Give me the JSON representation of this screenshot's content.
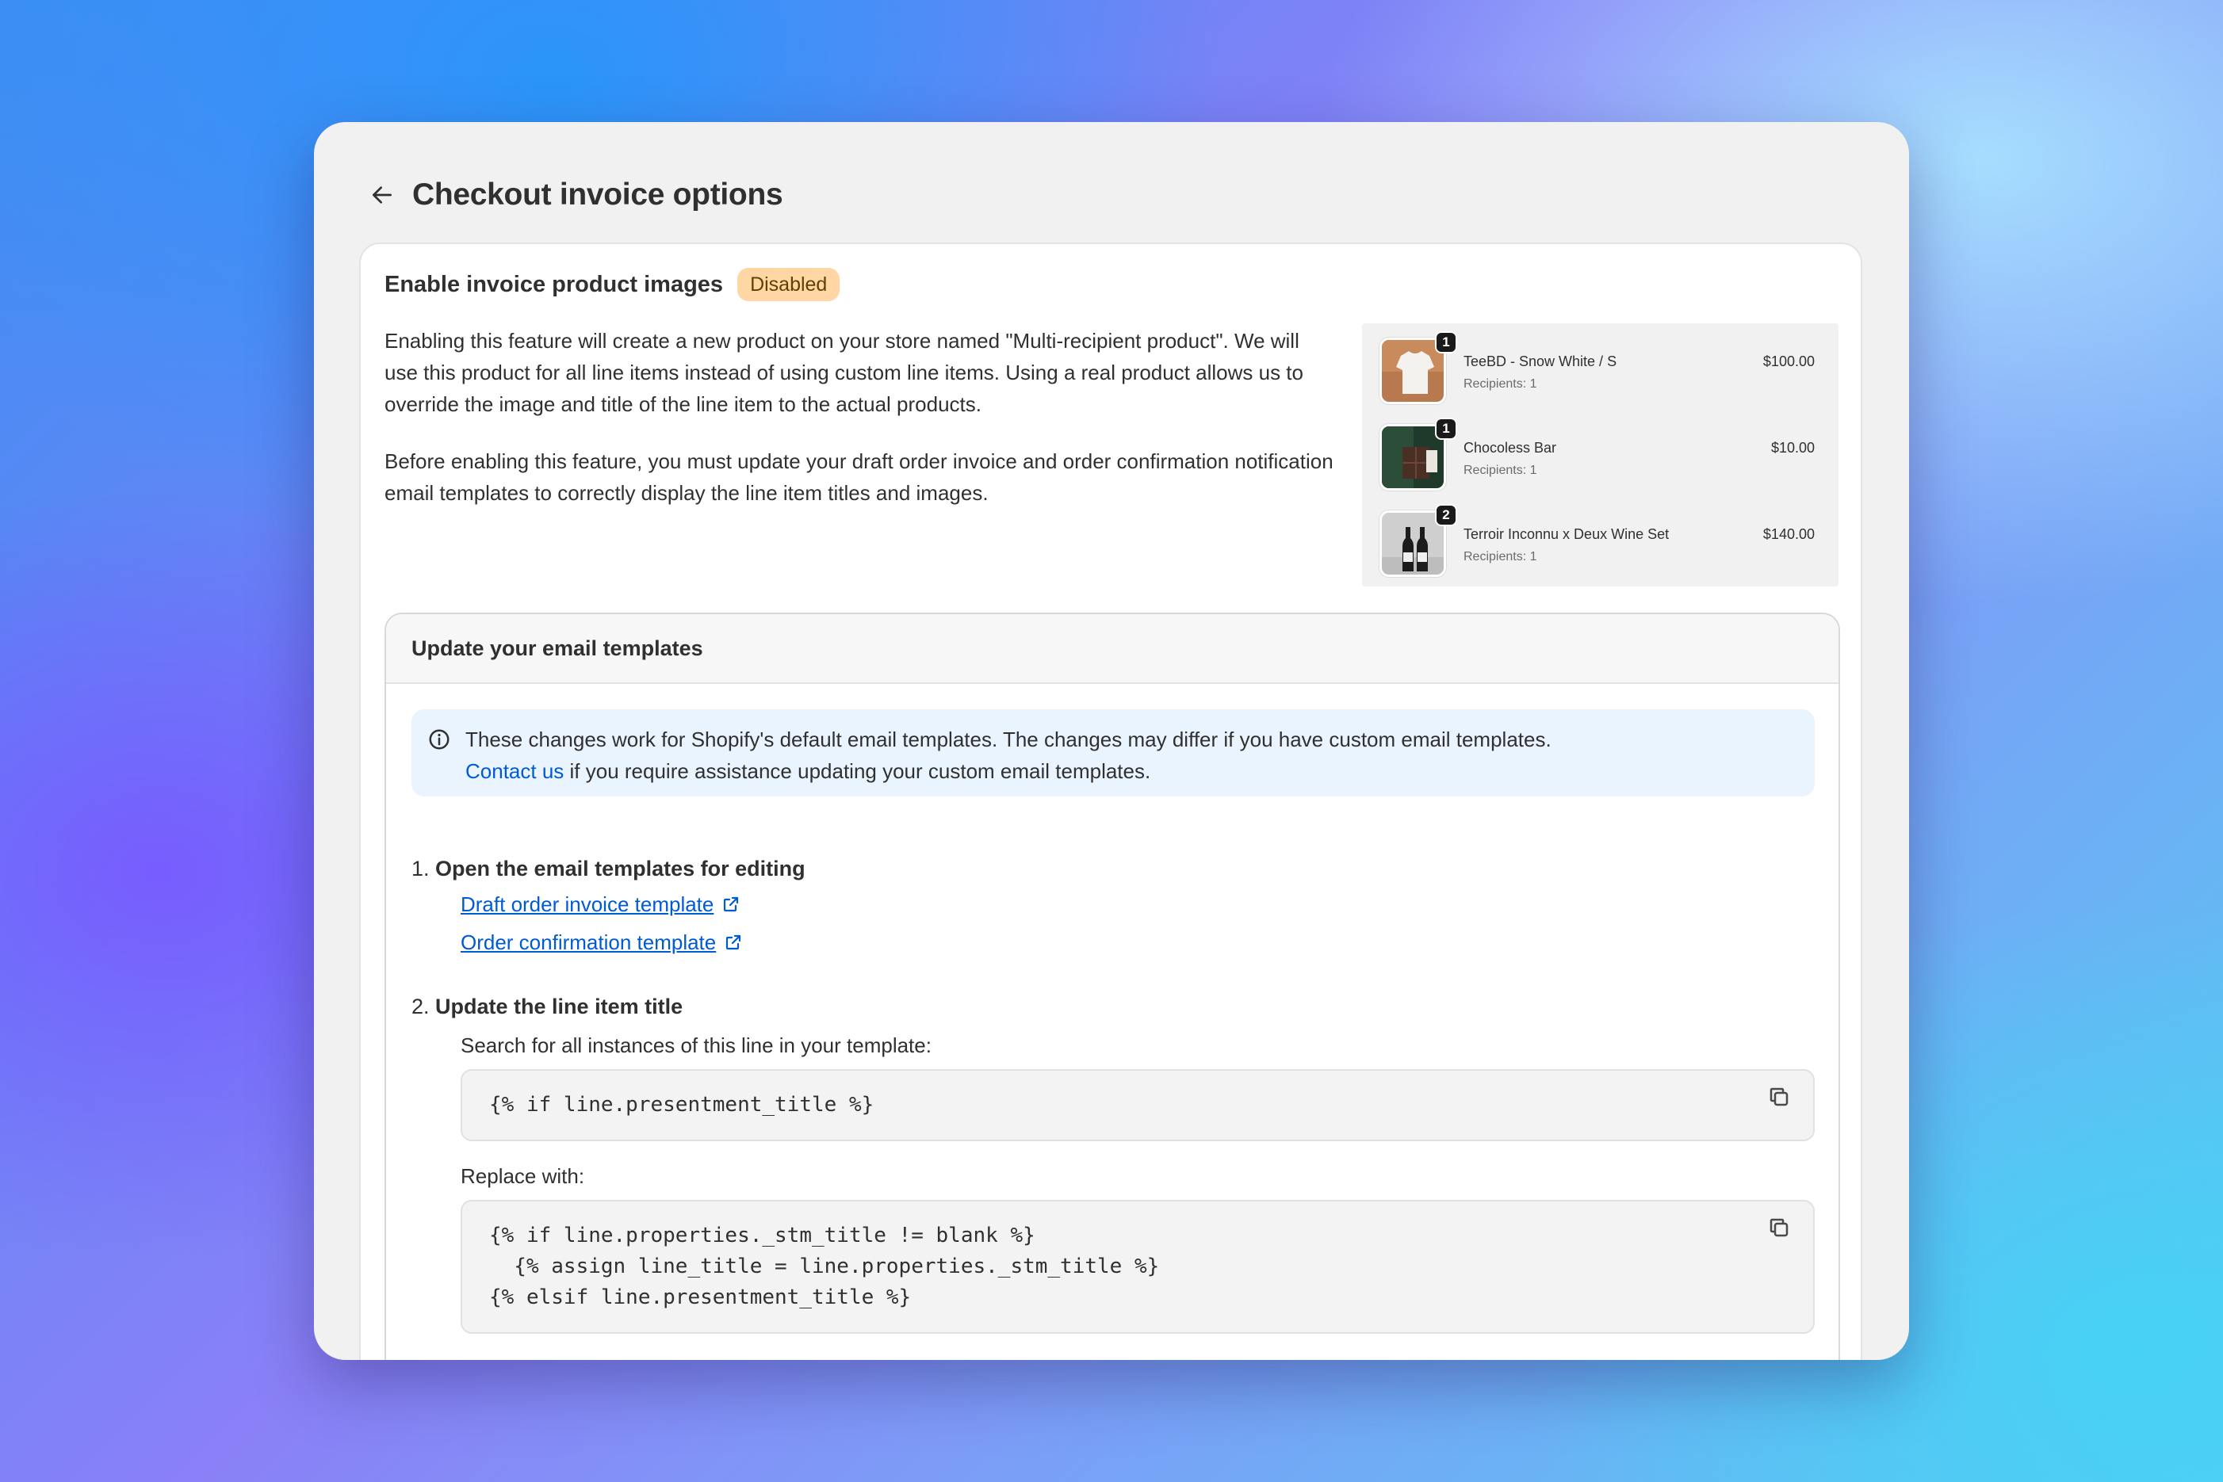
{
  "page": {
    "title": "Checkout invoice options"
  },
  "feature": {
    "title": "Enable invoice product images",
    "status": "Disabled",
    "paragraph1": "Enabling this feature will create a new product on your store named \"Multi-recipient product\". We will use this product for all line items instead of using custom line items. Using a real product allows us to override the image and title of the line item to the actual products.",
    "paragraph2": "Before enabling this feature, you must update your draft order invoice and order confirmation notification email templates to correctly display the line item titles and images."
  },
  "preview": {
    "items": [
      {
        "name": "TeeBD - Snow White / S",
        "recipients": "Recipients: 1",
        "price": "$100.00",
        "qty": "1"
      },
      {
        "name": "Chocoless Bar",
        "recipients": "Recipients: 1",
        "price": "$10.00",
        "qty": "1"
      },
      {
        "name": "Terroir Inconnu x Deux Wine Set",
        "recipients": "Recipients: 1",
        "price": "$140.00",
        "qty": "2"
      }
    ]
  },
  "templates": {
    "title": "Update your email templates",
    "banner_text": "These changes work for Shopify's default email templates. The changes may differ if you have custom email templates.",
    "banner_link": "Contact us",
    "banner_text2": " if you require assistance updating your custom email templates.",
    "step1": {
      "number": "1.",
      "title": "Open the email templates for editing",
      "links": [
        "Draft order invoice template",
        "Order confirmation template"
      ]
    },
    "step2": {
      "number": "2.",
      "title": "Update the line item title",
      "search_label": "Search for all instances of this line in your template:",
      "search_code": "{% if line.presentment_title %}",
      "replace_label": "Replace with:",
      "replace_code": "{% if line.properties._stm_title != blank %}\n  {% assign line_title = line.properties._stm_title %}\n{% elsif line.presentment_title %}"
    }
  },
  "colors": {
    "badge_bg": "#ffd6a4",
    "link": "#005bd3",
    "banner_bg": "#eaf4ff"
  },
  "icons": [
    "arrow-left-icon",
    "info-icon",
    "external-link-icon",
    "copy-icon"
  ]
}
